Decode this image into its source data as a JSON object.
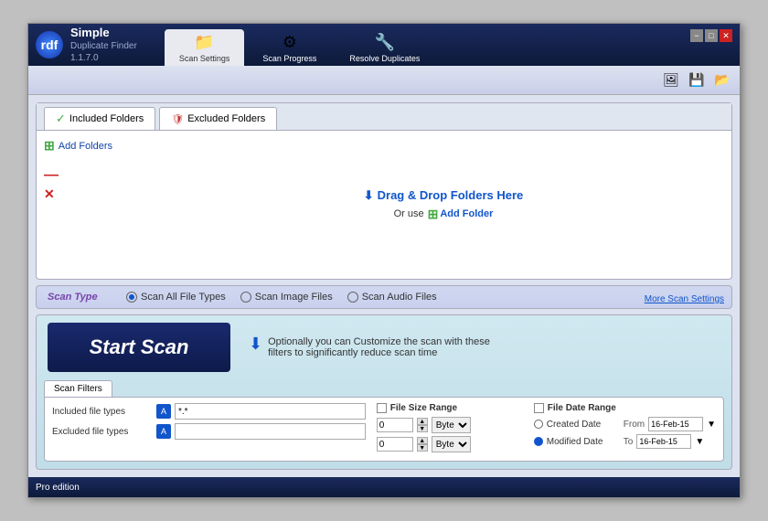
{
  "app": {
    "name": "Simple",
    "subtitle": "Duplicate Finder",
    "version": "1.1.7.0",
    "logo_text": "rdf"
  },
  "window_controls": {
    "minimize": "−",
    "maximize": "□",
    "close": "✕"
  },
  "tabs": [
    {
      "id": "scan-settings",
      "label": "Scan Settings",
      "icon": "📁",
      "active": true
    },
    {
      "id": "scan-progress",
      "label": "Scan Progress",
      "icon": "⚙",
      "active": false
    },
    {
      "id": "resolve-duplicates",
      "label": "Resolve Duplicates",
      "icon": "🔧",
      "active": false
    }
  ],
  "toolbar": {
    "icons": [
      "🖼",
      "💾",
      "📂"
    ]
  },
  "folders_panel": {
    "included_tab": "Included Folders",
    "excluded_tab": "Excluded Folders",
    "add_folders_label": "Add Folders",
    "drag_drop_text": "Drag & Drop Folders Here",
    "or_use_text": "Or use",
    "add_folder_link": "Add Folder"
  },
  "scan_type": {
    "label": "Scan Type",
    "options": [
      {
        "id": "all",
        "label": "Scan All File Types",
        "selected": true
      },
      {
        "id": "image",
        "label": "Scan Image Files",
        "selected": false
      },
      {
        "id": "audio",
        "label": "Scan Audio Files",
        "selected": false
      }
    ],
    "more_link": "More Scan Settings"
  },
  "start_scan": {
    "button_label": "Start Scan",
    "description_line1": "Optionally you can Customize the scan with these",
    "description_line2": "filters to significantly reduce scan time"
  },
  "scan_filters": {
    "tab_label": "Scan Filters",
    "included_file_types_label": "Included file types",
    "excluded_file_types_label": "Excluded file types",
    "included_value": "*.*",
    "excluded_value": "",
    "file_size_range": {
      "label": "File Size Range",
      "min_value": "0",
      "max_value": "0",
      "min_unit": "Byte",
      "max_unit": "Byte"
    },
    "file_date_range": {
      "label": "File Date Range",
      "created_date_label": "Created Date",
      "modified_date_label": "Modified Date",
      "modified_selected": true,
      "from_label": "From",
      "to_label": "To",
      "from_value": "16-Feb-15",
      "to_value": "16-Feb-15"
    }
  },
  "status_bar": {
    "text": "Pro edition"
  }
}
